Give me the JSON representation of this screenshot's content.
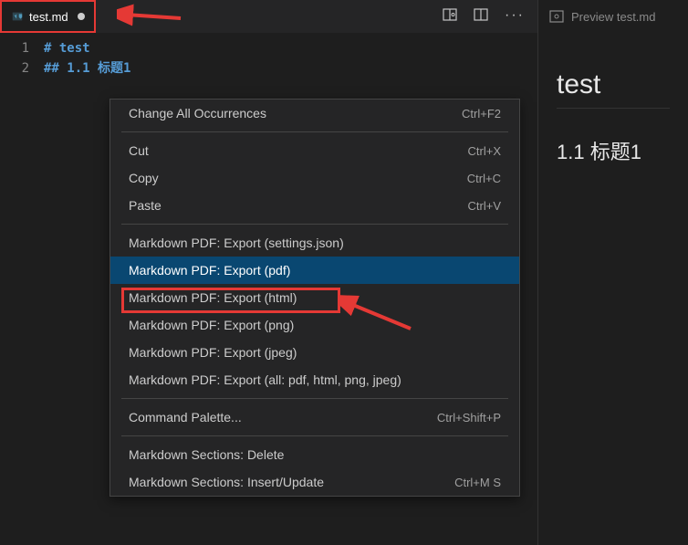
{
  "tab": {
    "filename": "test.md"
  },
  "previewTab": {
    "label": "Preview test.md"
  },
  "editor": {
    "lines": [
      {
        "num": "1",
        "text": "# test"
      },
      {
        "num": "2",
        "text": "## 1.1 标题1"
      }
    ]
  },
  "preview": {
    "h1": "test",
    "h2": "1.1 标题1"
  },
  "menu": {
    "changeAll": {
      "label": "Change All Occurrences",
      "shortcut": "Ctrl+F2"
    },
    "cut": {
      "label": "Cut",
      "shortcut": "Ctrl+X"
    },
    "copy": {
      "label": "Copy",
      "shortcut": "Ctrl+C"
    },
    "paste": {
      "label": "Paste",
      "shortcut": "Ctrl+V"
    },
    "mdSettings": {
      "label": "Markdown PDF: Export (settings.json)"
    },
    "mdPdf": {
      "label": "Markdown PDF: Export (pdf)"
    },
    "mdHtml": {
      "label": "Markdown PDF: Export (html)"
    },
    "mdPng": {
      "label": "Markdown PDF: Export (png)"
    },
    "mdJpeg": {
      "label": "Markdown PDF: Export (jpeg)"
    },
    "mdAll": {
      "label": "Markdown PDF: Export (all: pdf, html, png, jpeg)"
    },
    "cmdPalette": {
      "label": "Command Palette...",
      "shortcut": "Ctrl+Shift+P"
    },
    "secDelete": {
      "label": "Markdown Sections: Delete"
    },
    "secInsert": {
      "label": "Markdown Sections: Insert/Update",
      "shortcut": "Ctrl+M S"
    }
  }
}
